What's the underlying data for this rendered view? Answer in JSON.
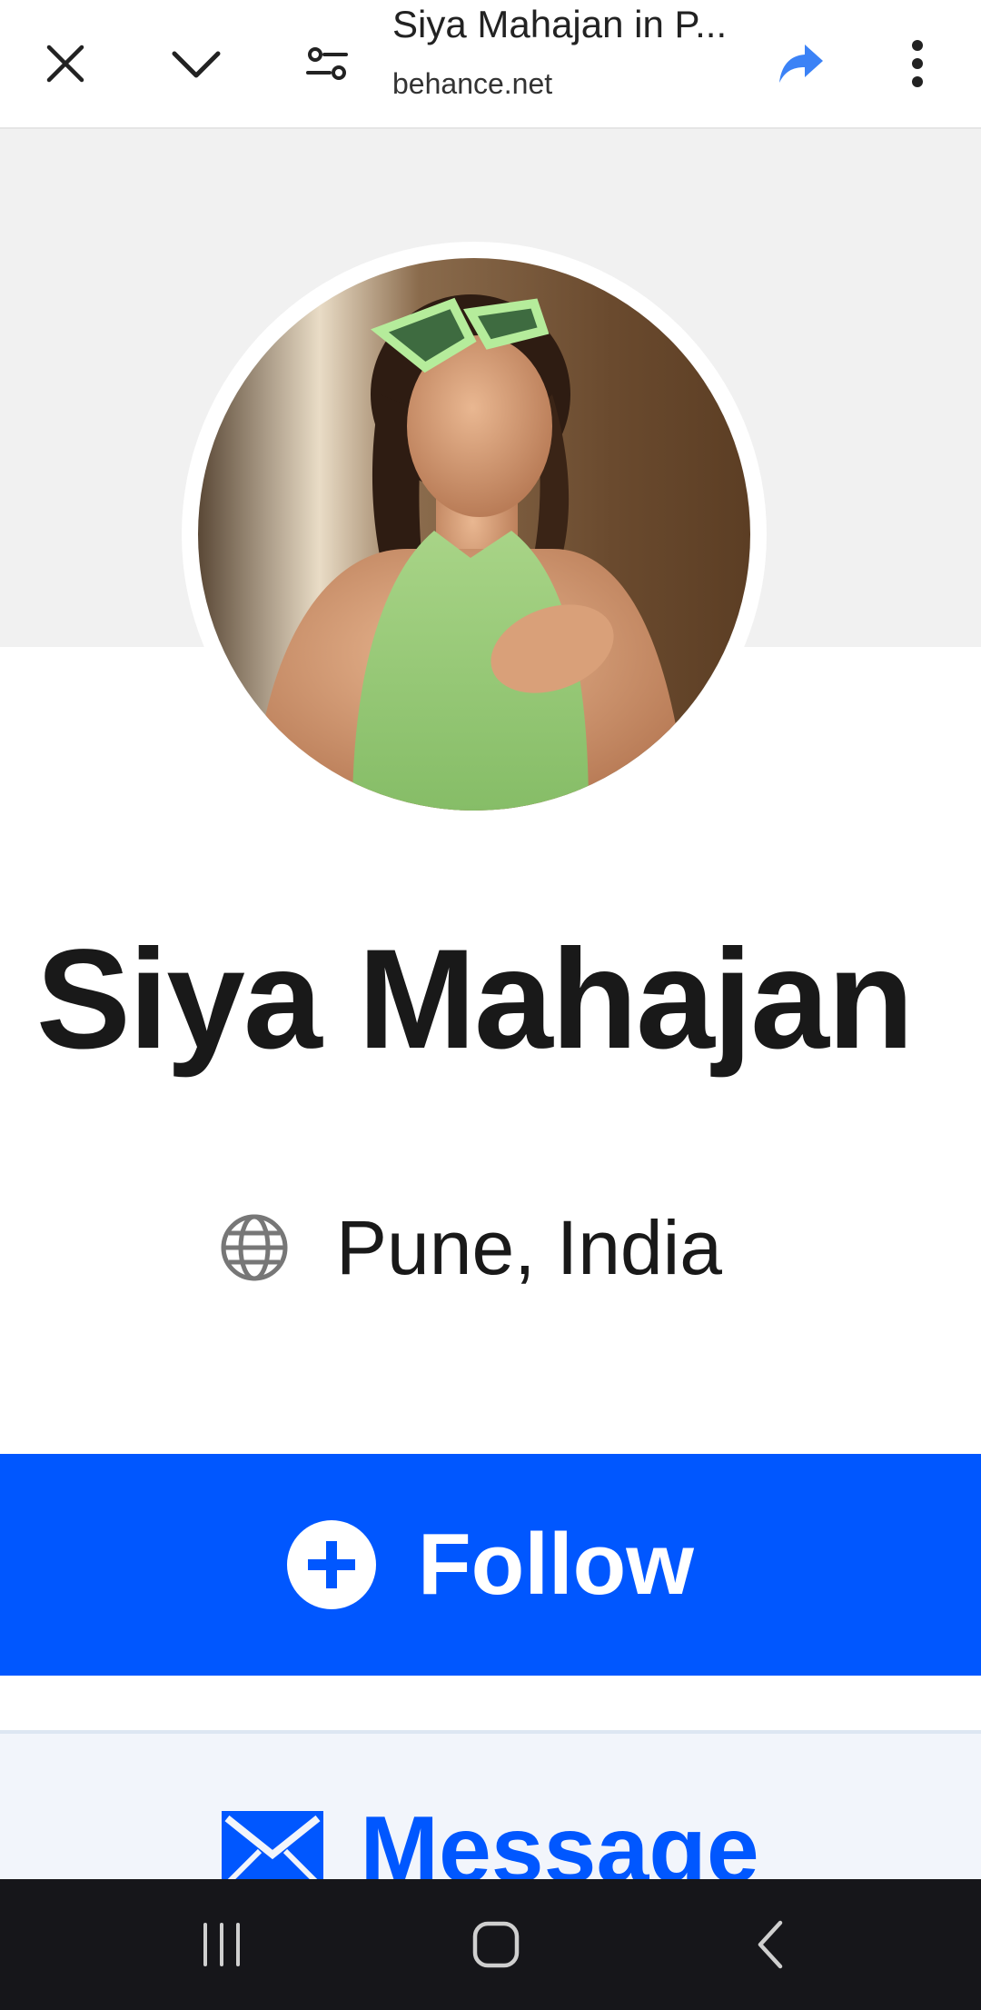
{
  "browser": {
    "title": "Siya Mahajan in P...",
    "url": "behance.net",
    "icons": {
      "close": "close-icon",
      "collapse": "chevron-down-icon",
      "site_settings": "tune-icon",
      "share": "share-icon",
      "menu": "more-vert-icon"
    },
    "share_color": "#3b82f6"
  },
  "profile": {
    "name": "Siya Mahajan",
    "location": "Pune, India",
    "location_icon": "globe-icon"
  },
  "actions": {
    "follow_label": "Follow",
    "follow_icon": "plus-circle-icon",
    "follow_color": "#0057ff",
    "message_label": "Message",
    "message_icon": "envelope-icon"
  },
  "system_nav": {
    "recents": "recents-icon",
    "home": "home-icon",
    "back": "back-icon"
  }
}
